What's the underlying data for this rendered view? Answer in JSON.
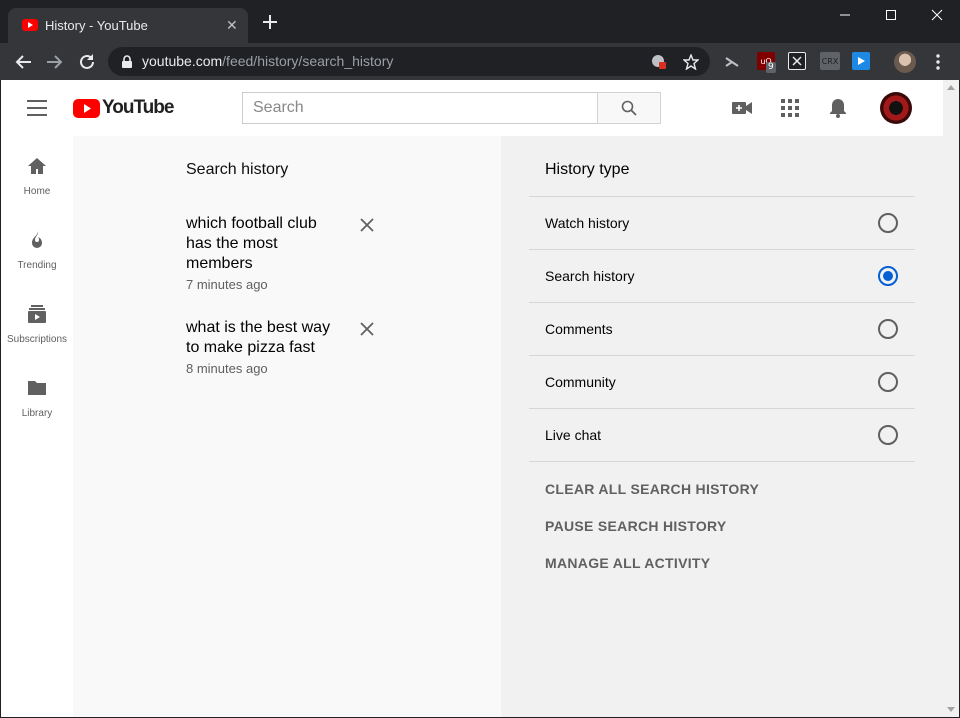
{
  "browser": {
    "tab_title": "History - YouTube",
    "tab_close_glyph": "✕",
    "url_host": "youtube.com",
    "url_path": "/feed/history/search_history",
    "extensions": [
      {
        "name": "ublock-origin",
        "color": "#800000",
        "badge": "9"
      },
      {
        "name": "extension-x",
        "color": "#202124"
      },
      {
        "name": "crx-extension",
        "color": "#5f6368",
        "text": "CRX"
      },
      {
        "name": "video-extension",
        "color": "#1e88e5"
      }
    ]
  },
  "youtube": {
    "logo_text": "YouTube",
    "search_placeholder": "Search",
    "brand_color": "#ff0000",
    "guide": [
      {
        "label": "Home",
        "icon": "home-icon"
      },
      {
        "label": "Trending",
        "icon": "trending-flame-icon"
      },
      {
        "label": "Subscriptions",
        "icon": "subscriptions-icon"
      },
      {
        "label": "Library",
        "icon": "library-folder-icon"
      }
    ],
    "search_history": {
      "title": "Search history",
      "entries": [
        {
          "query": "which football club has the most members",
          "time": "7 minutes ago"
        },
        {
          "query": "what is the best way to make pizza fast",
          "time": "8 minutes ago"
        }
      ]
    },
    "history_type": {
      "title": "History type",
      "options": [
        {
          "label": "Watch history",
          "selected": false
        },
        {
          "label": "Search history",
          "selected": true
        },
        {
          "label": "Comments",
          "selected": false
        },
        {
          "label": "Community",
          "selected": false
        },
        {
          "label": "Live chat",
          "selected": false
        }
      ],
      "actions": [
        "CLEAR ALL SEARCH HISTORY",
        "PAUSE SEARCH HISTORY",
        "MANAGE ALL ACTIVITY"
      ],
      "accent_color": "#065fd4"
    }
  }
}
